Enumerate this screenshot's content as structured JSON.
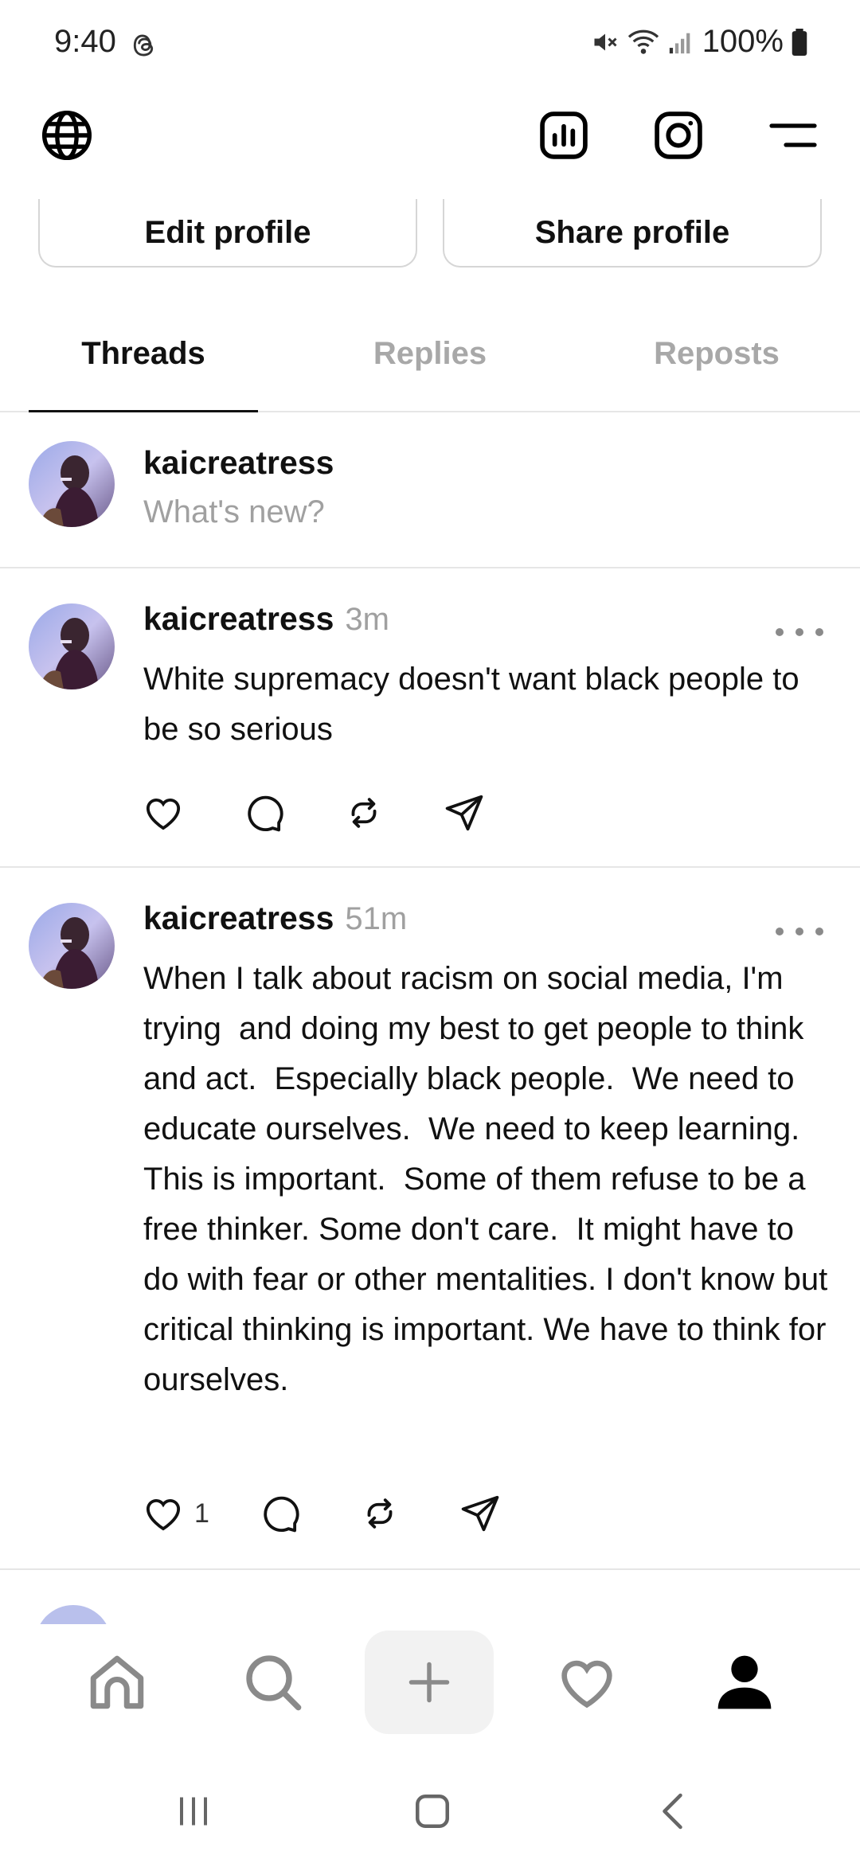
{
  "status_bar": {
    "time": "9:40",
    "battery": "100%",
    "icons": [
      "threads-notification-icon",
      "mute-icon",
      "wifi-icon",
      "signal-icon",
      "battery-icon"
    ]
  },
  "header": {
    "icons": [
      "globe-icon",
      "insights-icon",
      "instagram-icon",
      "menu-icon"
    ]
  },
  "profile_buttons": {
    "edit_label": "Edit profile",
    "share_label": "Share profile"
  },
  "tabs": [
    {
      "label": "Threads",
      "active": true
    },
    {
      "label": "Replies",
      "active": false
    },
    {
      "label": "Reposts",
      "active": false
    }
  ],
  "composer": {
    "username": "kaicreatress",
    "placeholder": "What's new?"
  },
  "posts": [
    {
      "username": "kaicreatress",
      "time": "3m",
      "text": "White supremacy doesn't want black people to be so serious",
      "likes": ""
    },
    {
      "username": "kaicreatress",
      "time": "51m",
      "text": "When I talk about racism on social media, I'm trying  and doing my best to get people to think and act.  Especially black people.  We need to educate ourselves.  We need to keep learning.  This is important.  Some of them refuse to be a free thinker. Some don't care.  It might have to do with fear or other mentalities. I don't know but critical thinking is important. We have to think for ourselves.",
      "likes": "1"
    }
  ],
  "bottom_nav": [
    "home-icon",
    "search-icon",
    "create-icon",
    "activity-icon",
    "profile-icon"
  ],
  "system_nav": [
    "recents-icon",
    "home-button-icon",
    "back-icon"
  ],
  "colors": {
    "text": "#111111",
    "muted": "#a0a0a0",
    "divider": "#e6e6e6"
  }
}
